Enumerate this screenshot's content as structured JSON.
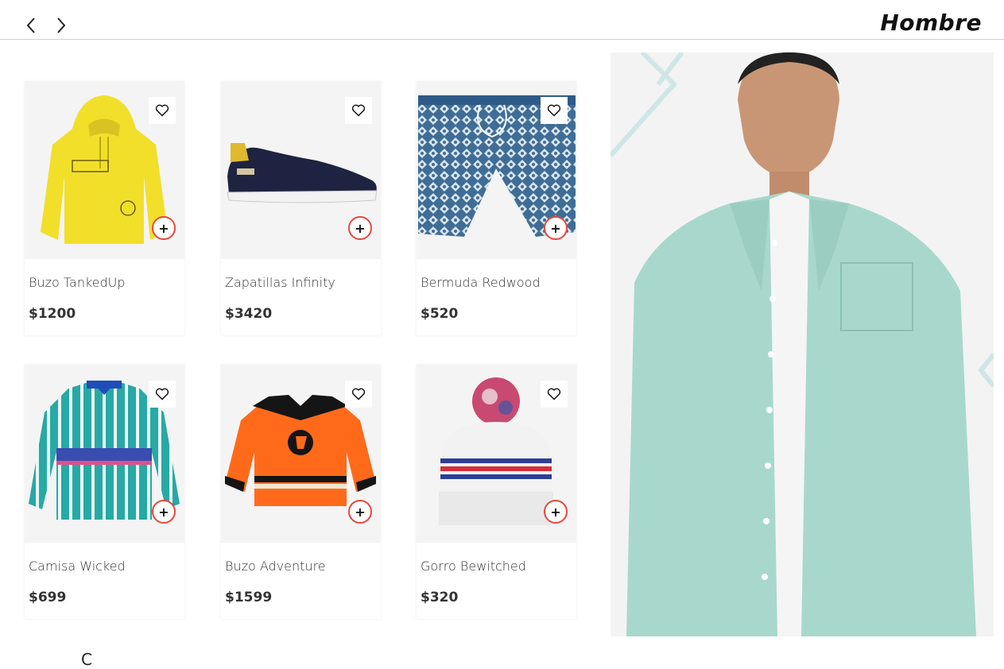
{
  "header": {
    "title": "Hombre",
    "prev_icon": "chevron-left-icon",
    "next_icon": "chevron-right-icon"
  },
  "products": [
    {
      "name": "Buzo TankedUp",
      "price": "$1200",
      "add_label": "+"
    },
    {
      "name": "Zapatillas Infinity",
      "price": "$3420",
      "add_label": "+"
    },
    {
      "name": "Bermuda Redwood",
      "price": "$520",
      "add_label": "+"
    },
    {
      "name": "Camisa Wicked",
      "price": "$699",
      "add_label": "+"
    },
    {
      "name": "Buzo Adventure",
      "price": "$1599",
      "add_label": "+"
    },
    {
      "name": "Gorro Bewitched",
      "price": "$320",
      "add_label": "+"
    }
  ],
  "colors": {
    "add_button_border": "#e6483e",
    "card_media_bg": "#f4f4f4",
    "hero_shirt": "#a8d8cc"
  },
  "footer_peek": "C"
}
